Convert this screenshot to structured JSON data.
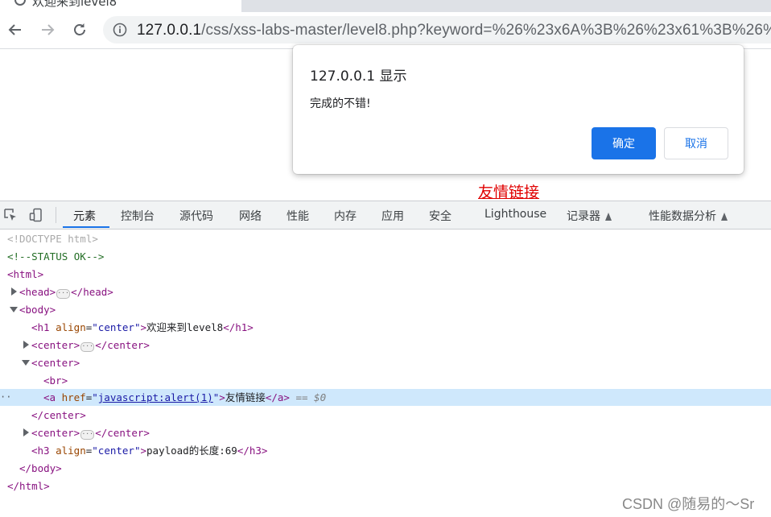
{
  "browser": {
    "tab_title": "欢迎来到level8",
    "url_host": "127.0.0.1",
    "url_path": "/css/xss-labs-master/level8.php?keyword=%26%23x6A%3B%26%23x61%3B%26%23x"
  },
  "dialog": {
    "title": "127.0.0.1 显示",
    "message": "完成的不错!",
    "ok_label": "确定",
    "cancel_label": "取消"
  },
  "page": {
    "link_text": "友情链接"
  },
  "devtools": {
    "tabs": [
      "元素",
      "控制台",
      "源代码",
      "网络",
      "性能",
      "内存",
      "应用",
      "安全",
      "Lighthouse",
      "记录器",
      "性能数据分析"
    ],
    "active_tab": "元素",
    "dom": {
      "doctype": "<!DOCTYPE html>",
      "comment": "<!--STATUS OK-->",
      "html_open": "<html>",
      "head": "<head>",
      "head_close": "</head>",
      "body_open": "<body>",
      "h1_tag": "<h1",
      "h1_attr": "align",
      "h1_val": "\"center\"",
      "h1_text": "欢迎来到level8",
      "h1_close": "</h1>",
      "center": "<center>",
      "center_close": "</center>",
      "br": "<br>",
      "a_tag": "<a",
      "a_attr": "href",
      "a_val": "javascript:alert(1)",
      "a_text": "友情链接",
      "a_close": "</a>",
      "selected_marker": "== $0",
      "h3_tag": "<h3",
      "h3_attr": "align",
      "h3_val": "\"center\"",
      "h3_text": "payload的长度:69",
      "h3_close": "</h3>",
      "body_close": "</body>",
      "html_close": "</html>"
    }
  },
  "watermark": "CSDN @随易的～Sr",
  "colors": {
    "accent": "#1a73e8",
    "link_red": "#e00000",
    "selection": "#cfe8fc"
  }
}
